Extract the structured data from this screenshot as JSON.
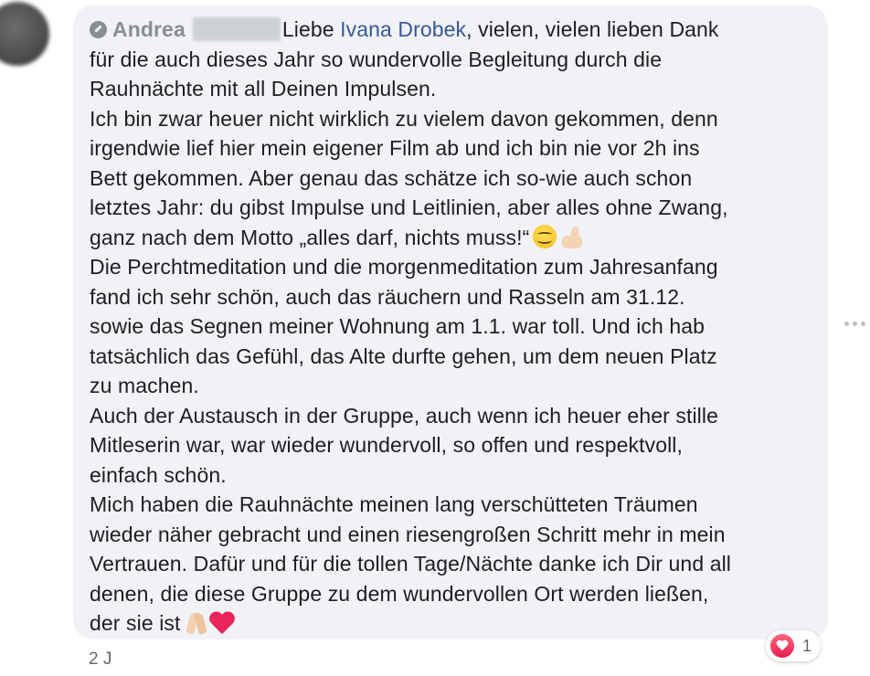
{
  "comment": {
    "author": "Andrea",
    "mention": "Ivana Drobek",
    "text_before_mention": "Liebe ",
    "lines": {
      "l1_after_mention": ", vielen, vielen lieben Dank",
      "l2": "für die auch dieses Jahr so wundervolle Begleitung durch die",
      "l3": "Rauhnächte mit all Deinen Impulsen.",
      "l4": "Ich bin zwar heuer nicht wirklich zu vielem davon gekommen, denn",
      "l5": "irgendwie lief hier mein eigener Film ab und ich bin nie vor 2h ins",
      "l6": "Bett gekommen. Aber genau das schätze ich so-wie auch schon",
      "l7": "letztes Jahr: du gibst Impulse und Leitlinien, aber alles ohne Zwang,",
      "l8": "ganz nach dem Motto „alles darf, nichts muss!“",
      "l9": "Die Perchtmeditation und die morgenmeditation zum Jahresanfang",
      "l10": "fand ich sehr schön, auch das räuchern und Rasseln am 31.12.",
      "l11": "sowie das Segnen meiner Wohnung am 1.1. war toll. Und ich hab",
      "l12": "tatsächlich das Gefühl, das Alte durfte gehen, um dem neuen Platz",
      "l13": "zu machen.",
      "l14": "Auch der Austausch in der Gruppe, auch wenn ich heuer eher stille",
      "l15": "Mitleserin war, war wieder wundervoll, so offen und respektvoll,",
      "l16": "einfach schön.",
      "l17": "Mich haben die Rauhnächte meinen lang verschütteten Träumen",
      "l18": "wieder näher gebracht und einen riesengroßen Schritt mehr in mein",
      "l19": "Vertrauen. Dafür und für die tollen Tage/Nächte danke ich Dir und all",
      "l20": "denen, die diese Gruppe zu dem wundervollen Ort werden ließen,",
      "l21": "der sie ist"
    },
    "icons": {
      "badge": "badge-icon",
      "emoji_1": "smiling-face-icon",
      "emoji_2": "thumbs-up-icon",
      "emoji_3": "folded-hands-icon",
      "emoji_4": "sparkling-heart-icon"
    }
  },
  "footer": {
    "timestamp": "2 J"
  },
  "reactions": {
    "icon": "love-reaction-icon",
    "count": "1",
    "color": "#e61e4d"
  },
  "colors": {
    "bubble_bg": "#f0f2f5",
    "mention": "#385898",
    "author": "#8a8d91"
  }
}
